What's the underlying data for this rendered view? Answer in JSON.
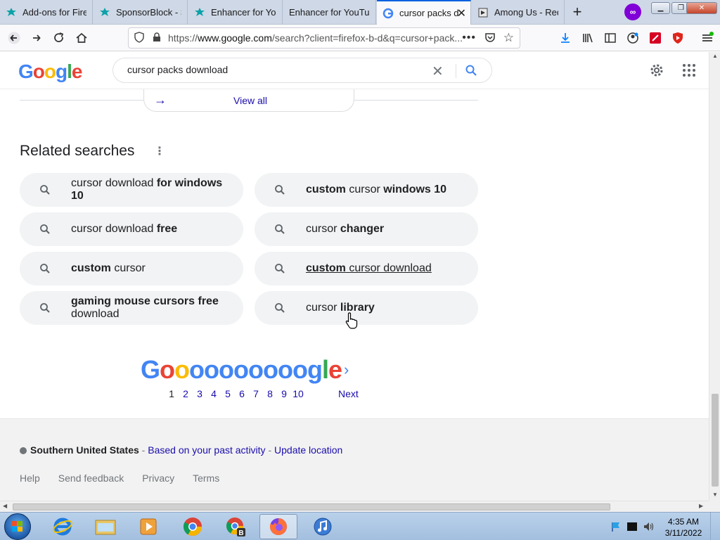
{
  "browser": {
    "tabs": [
      {
        "label": "Add-ons for Firef",
        "icon": "puzzle-icon",
        "active": false
      },
      {
        "label": "SponsorBlock - S",
        "icon": "puzzle-icon",
        "active": false
      },
      {
        "label": "Enhancer for You",
        "icon": "puzzle-icon",
        "active": false
      },
      {
        "label": "Enhancer for YouTub",
        "icon": "none",
        "active": false
      },
      {
        "label": "cursor packs d",
        "icon": "google-g-icon",
        "active": true
      },
      {
        "label": "Among Us - Red",
        "icon": "page-icon",
        "active": false
      }
    ],
    "url": "https://www.google.com/search?client=firefox-b-d&q=cursor+pack",
    "url_host": "www.google.com",
    "url_prefix": "https://",
    "url_suffix": "/search?client=firefox-b-d&q=cursor+pack..."
  },
  "google": {
    "logo_text": "Google",
    "query": "cursor packs download",
    "view_all": "View all",
    "related_title": "Related searches",
    "related": [
      {
        "plain": "cursor download ",
        "bold": "for windows 10",
        "order": "plain-bold",
        "underline": false
      },
      {
        "plain": " cursor ",
        "bold": "custom",
        "bold2": "windows 10",
        "order": "bold-plain-bold",
        "underline": false
      },
      {
        "plain": "cursor download ",
        "bold": "free",
        "order": "plain-bold",
        "underline": false
      },
      {
        "plain": "cursor ",
        "bold": "changer",
        "order": "plain-bold",
        "underline": false
      },
      {
        "plain": " cursor",
        "bold": "custom",
        "order": "bold-plain",
        "underline": false
      },
      {
        "plain": " cursor download",
        "bold": "custom",
        "order": "bold-plain",
        "underline": true
      },
      {
        "plain": " download",
        "bold": "gaming mouse cursors free",
        "order": "bold-plain",
        "underline": false
      },
      {
        "plain": "cursor ",
        "bold": "library",
        "order": "plain-bold",
        "underline": false
      }
    ],
    "pager": {
      "logo": "Goooooooooogle",
      "pages": [
        "1",
        "2",
        "3",
        "4",
        "5",
        "6",
        "7",
        "8",
        "9",
        "10"
      ],
      "current": "1",
      "next": "Next"
    },
    "footer": {
      "location": "Southern United States",
      "sep1": " - ",
      "based_on": "Based on your past activity",
      "sep2": " - ",
      "update": "Update location",
      "links": [
        "Help",
        "Send feedback",
        "Privacy",
        "Terms"
      ]
    }
  },
  "taskbar": {
    "time": "4:35 AM",
    "date": "3/11/2022"
  },
  "colors": {
    "link": "#1a0dab",
    "chip_bg": "#f1f3f4",
    "google_blue": "#4285f4",
    "google_red": "#ea4335",
    "google_yellow": "#fbbc05",
    "google_green": "#34a853"
  }
}
